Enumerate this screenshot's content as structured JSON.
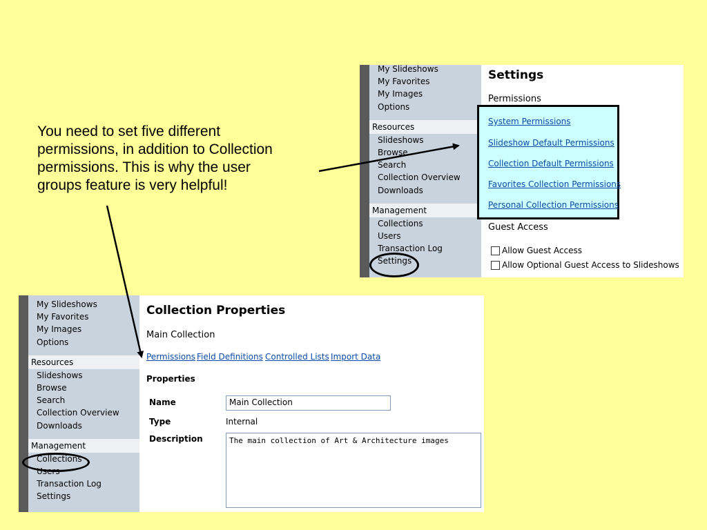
{
  "annotation": {
    "lines": [
      "You need to set five different",
      "permissions, in addition to Collection",
      "permissions.  This is why the user",
      "groups feature is very helpful!"
    ]
  },
  "settings_shot": {
    "nav_top": [
      "My Slideshows",
      "My Favorites",
      "My Images",
      "Options"
    ],
    "resources_header": "Resources",
    "resources": [
      "Slideshows",
      "Browse",
      "Search",
      "Collection Overview",
      "Downloads"
    ],
    "management_header": "Management",
    "management": [
      "Collections",
      "Users",
      "Transaction Log",
      "Settings"
    ],
    "title": "Settings",
    "permissions_heading": "Permissions",
    "permission_links": [
      "System Permissions",
      "Slideshow Default Permissions",
      "Collection Default Permissions",
      "Favorites Collection Permissions",
      "Personal Collection Permissions"
    ],
    "guest_heading": "Guest Access",
    "guest_options": [
      "Allow Guest Access",
      "Allow Optional Guest Access to Slideshows"
    ]
  },
  "collection_shot": {
    "nav_top": [
      "My Slideshows",
      "My Favorites",
      "My Images",
      "Options"
    ],
    "resources_header": "Resources",
    "resources": [
      "Slideshows",
      "Browse",
      "Search",
      "Collection Overview",
      "Downloads"
    ],
    "management_header": "Management",
    "management": [
      "Collections",
      "Users",
      "Transaction Log",
      "Settings"
    ],
    "title": "Collection Properties",
    "subtitle": "Main Collection",
    "tabs": [
      "Permissions",
      "Field Definitions",
      "Controlled Lists",
      "Import Data"
    ],
    "properties_heading": "Properties",
    "name_label": "Name",
    "name_value": "Main Collection",
    "type_label": "Type",
    "type_value": "Internal",
    "description_label": "Description",
    "description_value": "The main collection of Art & Architecture images"
  }
}
